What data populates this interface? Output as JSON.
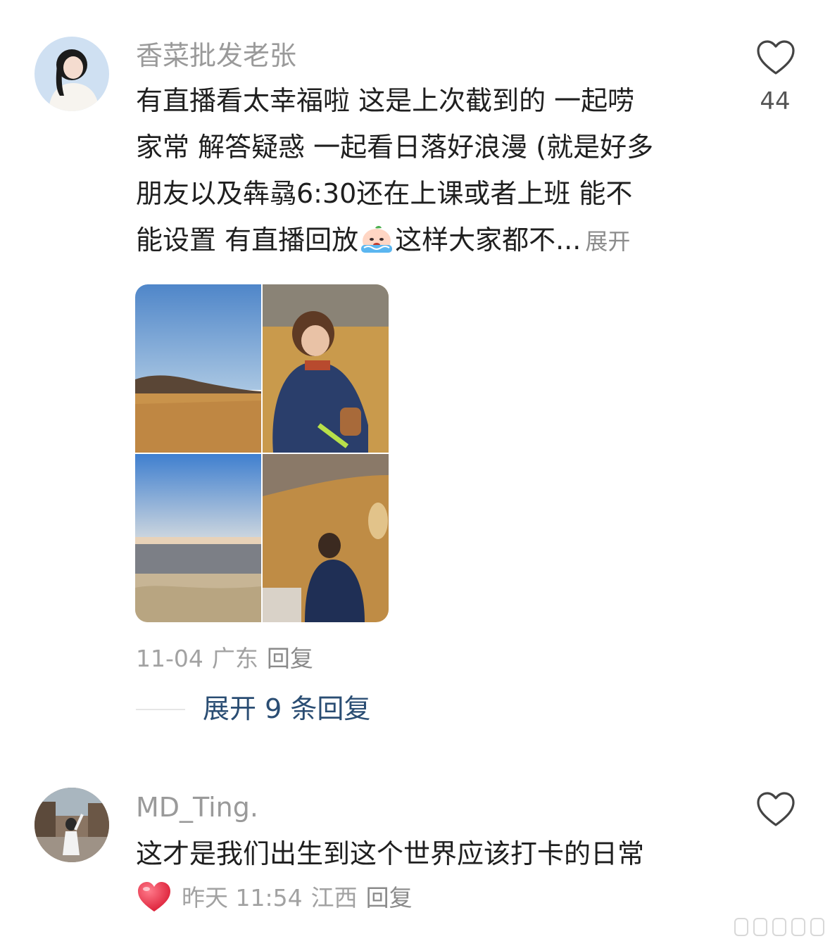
{
  "comments": [
    {
      "username": "香菜批发老张",
      "lines": [
        "有直播看太幸福啦 这是上次截到的 一起唠",
        "家常 解答疑惑 一起看日落好浪漫 (就是好多",
        "朋友以及犇骉6:30还在上课或者上班 能不"
      ],
      "last_line_before_emoji": "能设置 有直播回放",
      "last_line_after_emoji": "这样大家都不...",
      "expand_label": "展开",
      "like_count": "44",
      "date": "11-04",
      "location": "广东",
      "reply_label": "回复",
      "expand_replies_label": "展开 9 条回复",
      "emoji_icon": "crying-emoji-icon",
      "photos": [
        "grassland-sky-photo",
        "person-crouching-photo",
        "horizon-sky-photo",
        "person-with-dog-photo"
      ]
    },
    {
      "username": "MD_Ting.",
      "text": "这才是我们出生到这个世界应该打卡的日常",
      "date": "昨天 11:54",
      "location": "江西",
      "reply_label": "回复",
      "author_liked_icon": "red-heart-icon"
    }
  ],
  "colors": {
    "username": "#9a9a9a",
    "body": "#1f1f1f",
    "meta": "#a2a2a2",
    "link": "#2a4d73",
    "heart_red": "#e8253f"
  }
}
